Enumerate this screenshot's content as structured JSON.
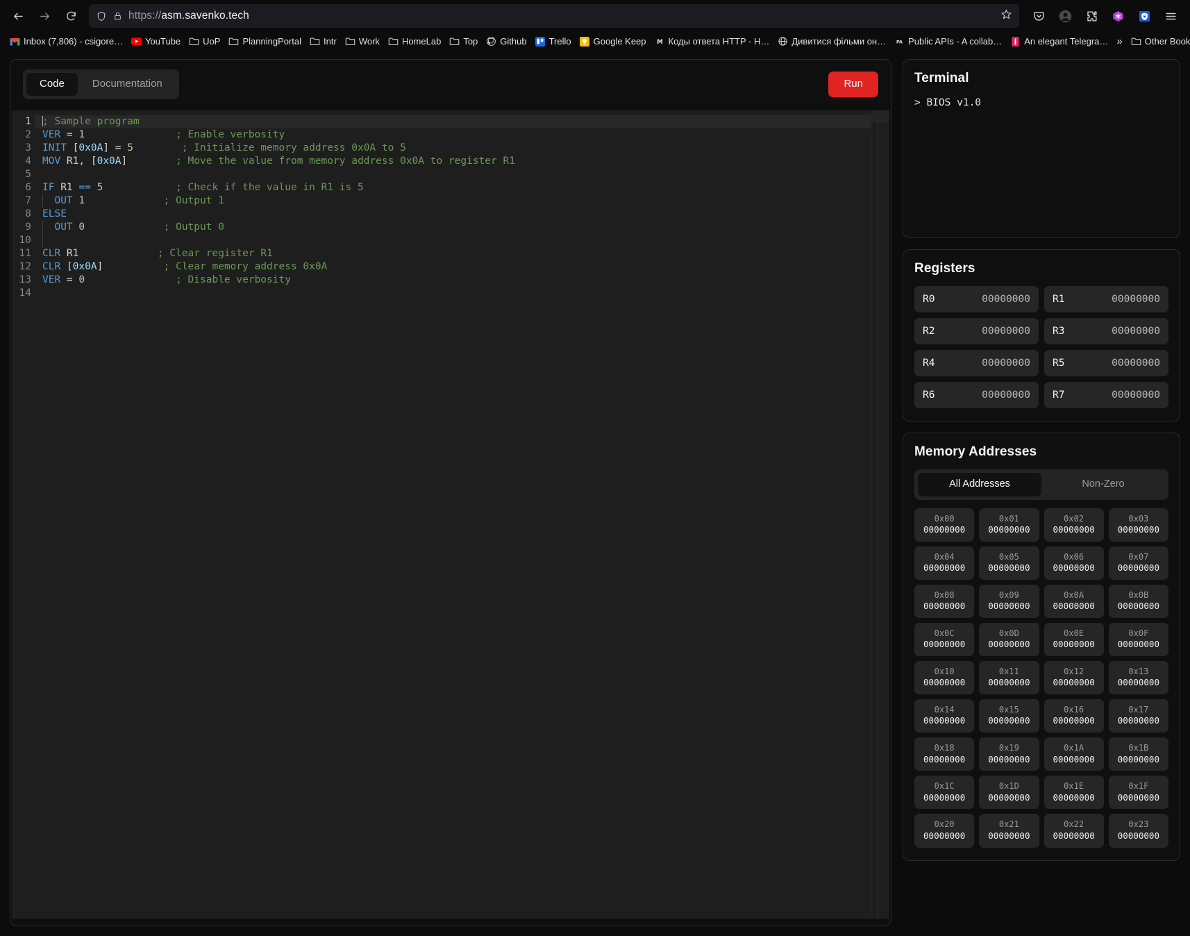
{
  "browser": {
    "back_icon": "back-arrow-icon",
    "forward_icon": "forward-arrow-icon",
    "reload_icon": "reload-icon",
    "shield_icon": "shield-icon",
    "lock_icon": "lock-icon",
    "url_prefix": "https://",
    "url_host": "asm.savenko.tech",
    "url_full": "https://asm.savenko.tech",
    "bookmark_star_icon": "star-icon",
    "toolbar_icons": [
      "pocket-icon",
      "account-avatar-icon",
      "extensions-puzzle-icon",
      "purple-cube-icon",
      "bitwarden-shield-icon",
      "hamburger-menu-icon"
    ],
    "bookmarks": [
      {
        "label": "Inbox (7,806) - csigore…",
        "icon": "gmail-icon"
      },
      {
        "label": "YouTube",
        "icon": "youtube-icon"
      },
      {
        "label": "UoP",
        "icon": "folder-icon"
      },
      {
        "label": "PlanningPortal",
        "icon": "folder-icon"
      },
      {
        "label": "Intr",
        "icon": "folder-icon"
      },
      {
        "label": "Work",
        "icon": "folder-icon"
      },
      {
        "label": "HomeLab",
        "icon": "folder-icon"
      },
      {
        "label": "Top",
        "icon": "folder-icon"
      },
      {
        "label": "Github",
        "icon": "github-icon"
      },
      {
        "label": "Trello",
        "icon": "trello-icon"
      },
      {
        "label": "Google Keep",
        "icon": "keep-icon"
      },
      {
        "label": "Коды ответа HTTP - H…",
        "icon": "mdn-icon"
      },
      {
        "label": "Дивитися фільми он…",
        "icon": "globe-icon"
      },
      {
        "label": "Public APIs - A collab…",
        "icon": "publicapis-icon"
      },
      {
        "label": "An elegant Telegra…",
        "icon": "telegraph-icon"
      }
    ],
    "overflow_label": "»",
    "other_bookmarks": "Other Bookmarks"
  },
  "editor": {
    "tabs": [
      {
        "label": "Code",
        "active": true
      },
      {
        "label": "Documentation",
        "active": false
      }
    ],
    "run_label": "Run",
    "line_count": 14,
    "active_line": 1,
    "code_lines": [
      {
        "num": 1,
        "segments": [
          {
            "t": "; Sample program",
            "c": "cm"
          }
        ],
        "active": true,
        "cursor": true
      },
      {
        "num": 2,
        "segments": [
          {
            "t": "VER",
            "c": "k"
          },
          {
            "t": " = ",
            "c": "op"
          },
          {
            "t": "1",
            "c": "n"
          },
          {
            "t": "               ",
            "c": "op"
          },
          {
            "t": "; Enable verbosity",
            "c": "cm"
          }
        ]
      },
      {
        "num": 3,
        "segments": [
          {
            "t": "INIT",
            "c": "k"
          },
          {
            "t": " [",
            "c": "op"
          },
          {
            "t": "0x0A",
            "c": "mem"
          },
          {
            "t": "] = ",
            "c": "op"
          },
          {
            "t": "5",
            "c": "n"
          },
          {
            "t": "        ",
            "c": "op"
          },
          {
            "t": "; Initialize memory address 0x0A to 5",
            "c": "cm"
          }
        ]
      },
      {
        "num": 4,
        "segments": [
          {
            "t": "MOV",
            "c": "k"
          },
          {
            "t": " R1, [",
            "c": "op"
          },
          {
            "t": "0x0A",
            "c": "mem"
          },
          {
            "t": "]",
            "c": "op"
          },
          {
            "t": "        ",
            "c": "op"
          },
          {
            "t": "; Move the value from memory address 0x0A to register R1",
            "c": "cm"
          }
        ]
      },
      {
        "num": 5,
        "segments": []
      },
      {
        "num": 6,
        "segments": [
          {
            "t": "IF",
            "c": "k"
          },
          {
            "t": " R1 ",
            "c": "op"
          },
          {
            "t": "==",
            "c": "k"
          },
          {
            "t": " ",
            "c": "op"
          },
          {
            "t": "5",
            "c": "n"
          },
          {
            "t": "            ",
            "c": "op"
          },
          {
            "t": "; Check if the value in R1 is 5",
            "c": "cm"
          }
        ]
      },
      {
        "num": 7,
        "guide": true,
        "segments": [
          {
            "t": "  ",
            "c": "op"
          },
          {
            "t": "OUT",
            "c": "k"
          },
          {
            "t": " ",
            "c": "op"
          },
          {
            "t": "1",
            "c": "n"
          },
          {
            "t": "             ",
            "c": "op"
          },
          {
            "t": "; Output 1",
            "c": "cm"
          }
        ]
      },
      {
        "num": 8,
        "segments": [
          {
            "t": "ELSE",
            "c": "k"
          }
        ]
      },
      {
        "num": 9,
        "guide": true,
        "segments": [
          {
            "t": "  ",
            "c": "op"
          },
          {
            "t": "OUT",
            "c": "k"
          },
          {
            "t": " ",
            "c": "op"
          },
          {
            "t": "0",
            "c": "n"
          },
          {
            "t": "             ",
            "c": "op"
          },
          {
            "t": "; Output 0",
            "c": "cm"
          }
        ]
      },
      {
        "num": 10,
        "guide": true,
        "segments": []
      },
      {
        "num": 11,
        "segments": [
          {
            "t": "CLR",
            "c": "k"
          },
          {
            "t": " R1",
            "c": "op"
          },
          {
            "t": "             ",
            "c": "op"
          },
          {
            "t": "; Clear register R1",
            "c": "cm"
          }
        ]
      },
      {
        "num": 12,
        "segments": [
          {
            "t": "CLR",
            "c": "k"
          },
          {
            "t": " [",
            "c": "op"
          },
          {
            "t": "0x0A",
            "c": "mem"
          },
          {
            "t": "]",
            "c": "op"
          },
          {
            "t": "          ",
            "c": "op"
          },
          {
            "t": "; Clear memory address 0x0A",
            "c": "cm"
          }
        ]
      },
      {
        "num": 13,
        "segments": [
          {
            "t": "VER",
            "c": "k"
          },
          {
            "t": " = ",
            "c": "op"
          },
          {
            "t": "0",
            "c": "n"
          },
          {
            "t": "               ",
            "c": "op"
          },
          {
            "t": "; Disable verbosity",
            "c": "cm"
          }
        ]
      },
      {
        "num": 14,
        "segments": []
      }
    ]
  },
  "terminal": {
    "title": "Terminal",
    "lines": [
      "> BIOS v1.0"
    ]
  },
  "registers": {
    "title": "Registers",
    "items": [
      {
        "name": "R0",
        "value": "00000000"
      },
      {
        "name": "R1",
        "value": "00000000"
      },
      {
        "name": "R2",
        "value": "00000000"
      },
      {
        "name": "R3",
        "value": "00000000"
      },
      {
        "name": "R4",
        "value": "00000000"
      },
      {
        "name": "R5",
        "value": "00000000"
      },
      {
        "name": "R6",
        "value": "00000000"
      },
      {
        "name": "R7",
        "value": "00000000"
      }
    ]
  },
  "memory": {
    "title": "Memory Addresses",
    "filters": [
      {
        "label": "All Addresses",
        "active": true
      },
      {
        "label": "Non-Zero",
        "active": false
      }
    ],
    "cells": [
      {
        "addr": "0x00",
        "value": "00000000"
      },
      {
        "addr": "0x01",
        "value": "00000000"
      },
      {
        "addr": "0x02",
        "value": "00000000"
      },
      {
        "addr": "0x03",
        "value": "00000000"
      },
      {
        "addr": "0x04",
        "value": "00000000"
      },
      {
        "addr": "0x05",
        "value": "00000000"
      },
      {
        "addr": "0x06",
        "value": "00000000"
      },
      {
        "addr": "0x07",
        "value": "00000000"
      },
      {
        "addr": "0x08",
        "value": "00000000"
      },
      {
        "addr": "0x09",
        "value": "00000000"
      },
      {
        "addr": "0x0A",
        "value": "00000000"
      },
      {
        "addr": "0x0B",
        "value": "00000000"
      },
      {
        "addr": "0x0C",
        "value": "00000000"
      },
      {
        "addr": "0x0D",
        "value": "00000000"
      },
      {
        "addr": "0x0E",
        "value": "00000000"
      },
      {
        "addr": "0x0F",
        "value": "00000000"
      },
      {
        "addr": "0x10",
        "value": "00000000"
      },
      {
        "addr": "0x11",
        "value": "00000000"
      },
      {
        "addr": "0x12",
        "value": "00000000"
      },
      {
        "addr": "0x13",
        "value": "00000000"
      },
      {
        "addr": "0x14",
        "value": "00000000"
      },
      {
        "addr": "0x15",
        "value": "00000000"
      },
      {
        "addr": "0x16",
        "value": "00000000"
      },
      {
        "addr": "0x17",
        "value": "00000000"
      },
      {
        "addr": "0x18",
        "value": "00000000"
      },
      {
        "addr": "0x19",
        "value": "00000000"
      },
      {
        "addr": "0x1A",
        "value": "00000000"
      },
      {
        "addr": "0x1B",
        "value": "00000000"
      },
      {
        "addr": "0x1C",
        "value": "00000000"
      },
      {
        "addr": "0x1D",
        "value": "00000000"
      },
      {
        "addr": "0x1E",
        "value": "00000000"
      },
      {
        "addr": "0x1F",
        "value": "00000000"
      },
      {
        "addr": "0x20",
        "value": "00000000"
      },
      {
        "addr": "0x21",
        "value": "00000000"
      },
      {
        "addr": "0x22",
        "value": "00000000"
      },
      {
        "addr": "0x23",
        "value": "00000000"
      }
    ]
  },
  "colors": {
    "accent_run": "#e02424",
    "panel_bg": "#0f0f0f",
    "panel_border": "#2b2b2b",
    "editor_bg": "#1e1e1e",
    "comment": "#6a9955",
    "keyword": "#569cd6",
    "number": "#b5cea8"
  }
}
